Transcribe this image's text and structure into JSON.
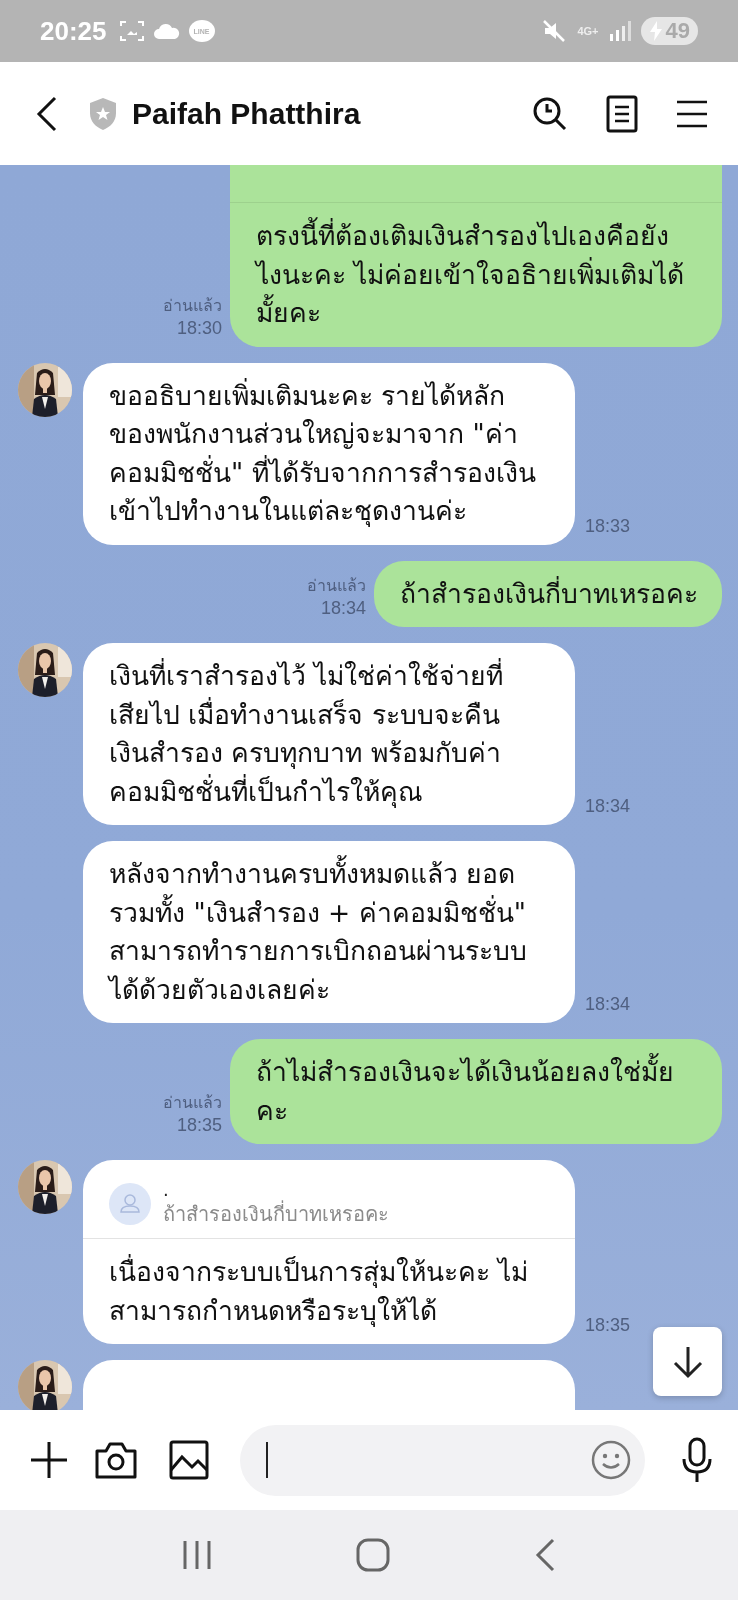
{
  "status_bar": {
    "time": "20:25",
    "notification_logo": "LINE",
    "network": "4G+",
    "battery": "49"
  },
  "header": {
    "title": "Paifah Phatthira"
  },
  "messages": [
    {
      "kind": "outgoing",
      "top_cut": true,
      "read_label": "อ่านแล้ว",
      "time": "18:30",
      "text": "ตรงนี้ที่ต้องเติมเงินสำรองไปเองคือยัง\nไงนะคะ ไม่ค่อยเข้าใจอธิายเพิ่มเติมได้\nมั้ยคะ"
    },
    {
      "kind": "incoming",
      "avatar": true,
      "time": "18:33",
      "text": "ขออธิบายเพิ่มเติมนะคะ รายได้หลัก\nของพนักงานส่วนใหญ่จะมาจาก \"ค่า\nคอมมิชชั่น\" ที่ได้รับจากการสำรองเงิน\nเข้าไปทำงานในแต่ละชุดงานค่ะ"
    },
    {
      "kind": "outgoing",
      "top_cut": false,
      "read_label": "อ่านแล้ว",
      "time": "18:34",
      "text": "ถ้าสำรองเงินกี่บาทเหรอคะ"
    },
    {
      "kind": "incoming",
      "avatar": true,
      "time": "18:34",
      "text": "เงินที่เราสำรองไว้ ไม่ใช่ค่าใช้จ่ายที่\nเสียไป เมื่อทำงานเสร็จ ระบบจะคืน\nเงินสำรอง ครบทุกบาท พร้อมกับค่า\nคอมมิชชั่นที่เป็นกำไรให้คุณ"
    },
    {
      "kind": "incoming",
      "avatar": false,
      "time": "18:34",
      "text": "หลังจากทำงานครบทั้งหมดแล้ว ยอด\nรวมทั้ง \"เงินสำรอง + ค่าคอมมิชชั่น\"\nสามารถทำรายการเบิกถอนผ่านระบบ\nได้ด้วยตัวเองเลยค่ะ"
    },
    {
      "kind": "outgoing",
      "top_cut": false,
      "read_label": "อ่านแล้ว",
      "time": "18:35",
      "text": "ถ้าไม่สำรองเงินจะได้เงินน้อยลงใช่มั้ย\nคะ"
    },
    {
      "kind": "reply",
      "avatar": true,
      "time": "18:35",
      "quote": {
        "name": ".",
        "text": "ถ้าสำรองเงินกี่บาทเหรอคะ"
      },
      "text": "เนื่องจากระบบเป็นการสุ่มให้นะคะ ไม่\nสามารถกำหนดหรือระบุให้ได้"
    },
    {
      "kind": "partial",
      "avatar": true
    }
  ]
}
